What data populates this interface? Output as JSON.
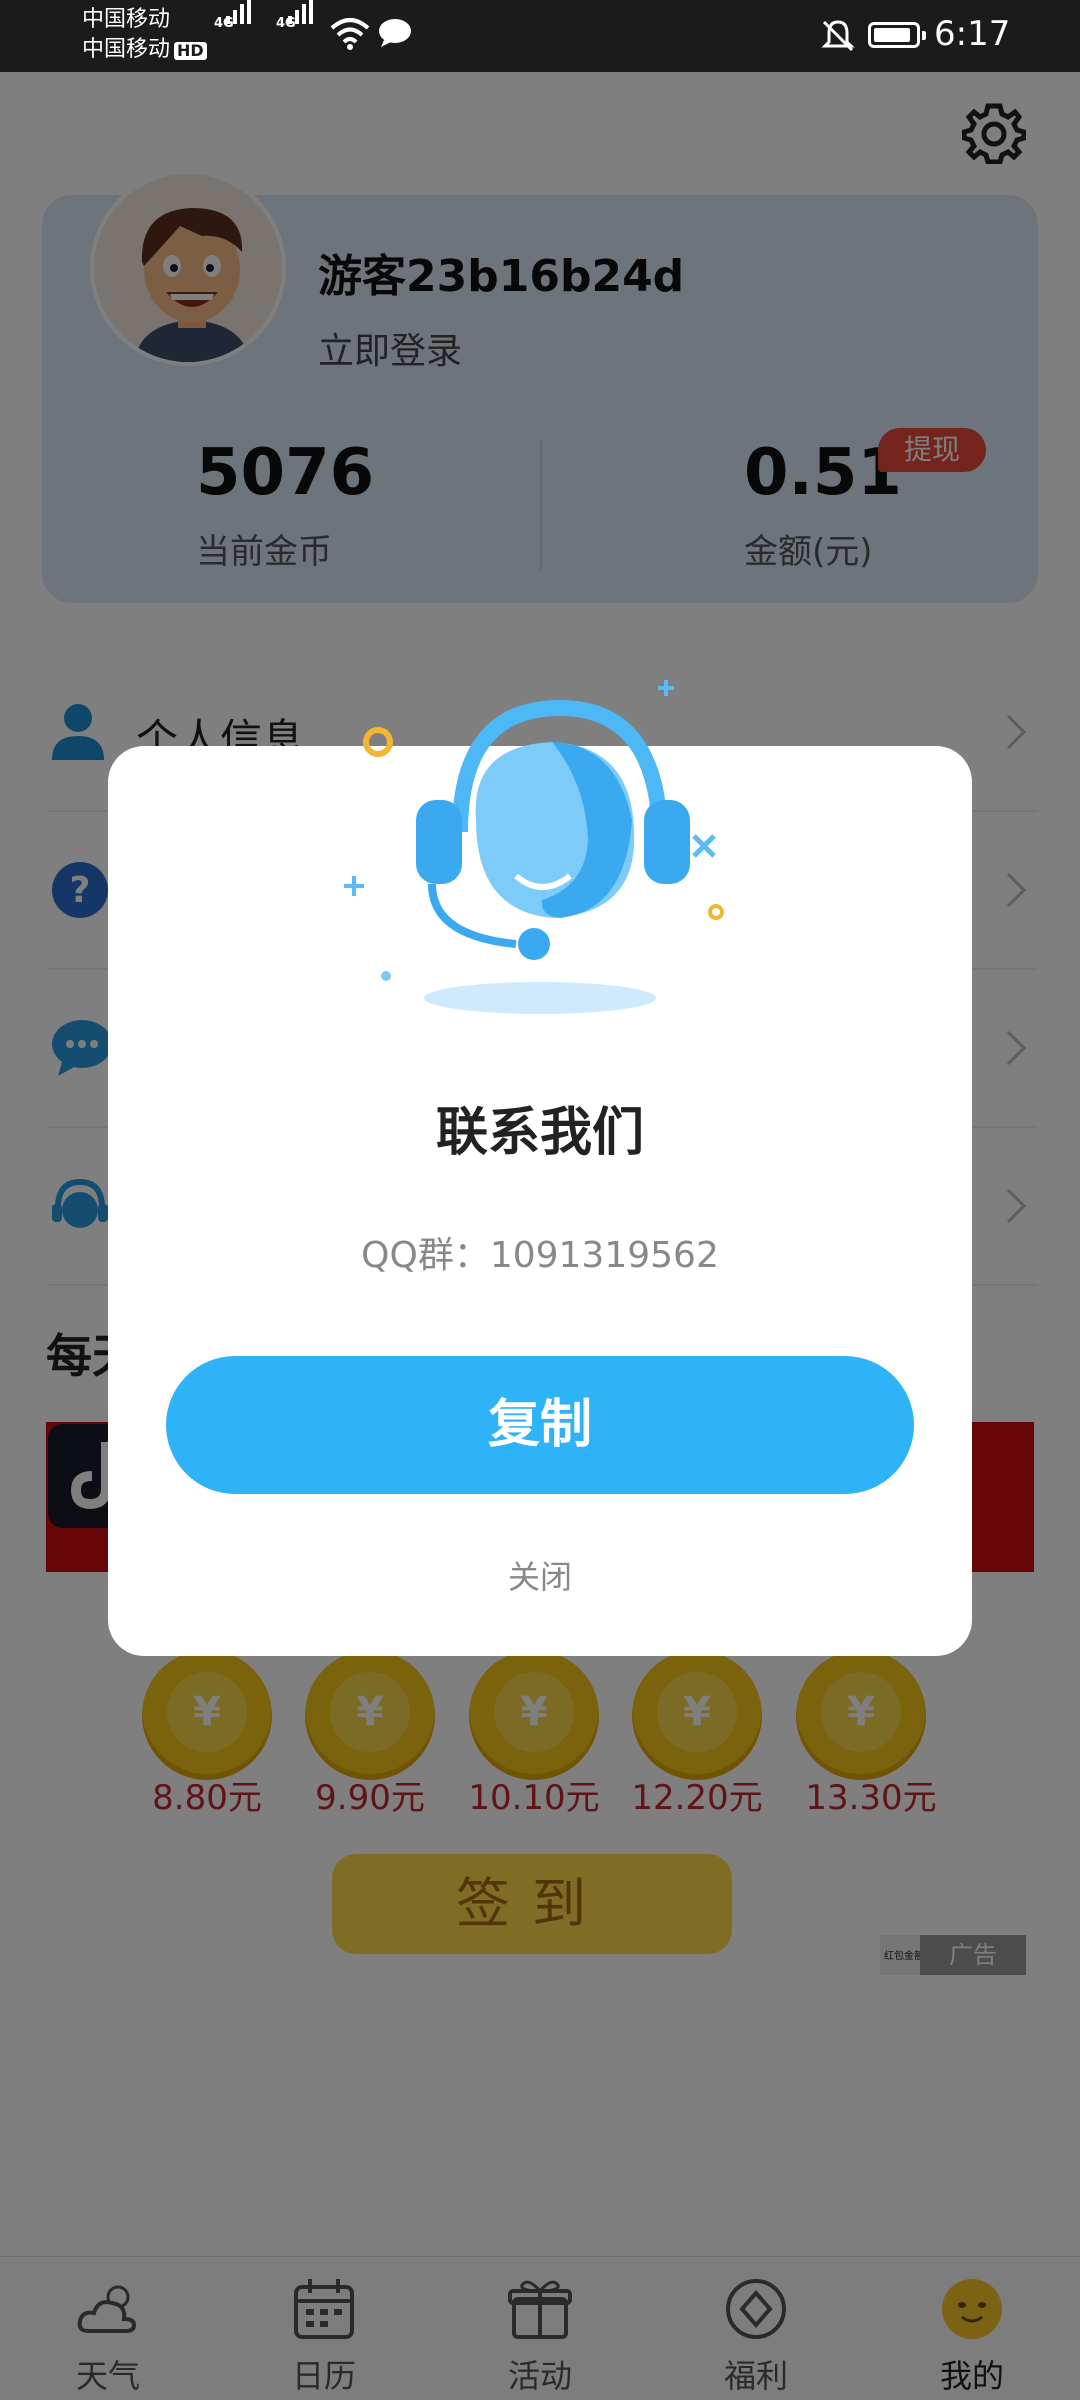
{
  "status_bar": {
    "carrier_1": "中国移动",
    "carrier_2": "中国移动",
    "hd_badge": "HD",
    "net_1": "4G",
    "net_2": "4G",
    "time": "6:17"
  },
  "profile": {
    "username": "游客23b16b24d",
    "login_link": "立即登录",
    "coins_value": "5076",
    "coins_label": "当前金币",
    "amount_value": "0.51",
    "amount_label": "金额(元)",
    "withdraw_label": "提现"
  },
  "menu": {
    "items": [
      {
        "label": "个人信息",
        "icon": "person-icon",
        "color": "#1f8fd6"
      },
      {
        "label": "",
        "icon": "help-icon",
        "color": "#2a6fd1"
      },
      {
        "label": "",
        "icon": "chat-icon",
        "color": "#2b9be0"
      },
      {
        "label": "",
        "icon": "customer-service-icon",
        "color": "#2b9be0"
      }
    ]
  },
  "daily": {
    "heading": "每天",
    "rewards": [
      "8.80元",
      "9.90元",
      "10.10元",
      "12.20元",
      "13.30元"
    ],
    "coin_symbol": "¥",
    "signin_label": "签到"
  },
  "ad": {
    "tag": "广告",
    "text": "红包金额最高领取金额为…"
  },
  "bottom_nav": {
    "items": [
      {
        "label": "天气",
        "icon": "weather-icon"
      },
      {
        "label": "日历",
        "icon": "calendar-icon"
      },
      {
        "label": "活动",
        "icon": "gift-icon"
      },
      {
        "label": "福利",
        "icon": "diamond-icon"
      },
      {
        "label": "我的",
        "icon": "profile-face-icon"
      }
    ],
    "active_index": 4
  },
  "modal": {
    "title": "联系我们",
    "qq_text": "QQ群：1091319562",
    "copy_label": "复制",
    "close_label": "关闭"
  },
  "colors": {
    "accent": "#2eb2f8",
    "card_bg": "#dde9f8",
    "badge_red": "#e8493a",
    "coin_gold": "#f6c51a"
  }
}
